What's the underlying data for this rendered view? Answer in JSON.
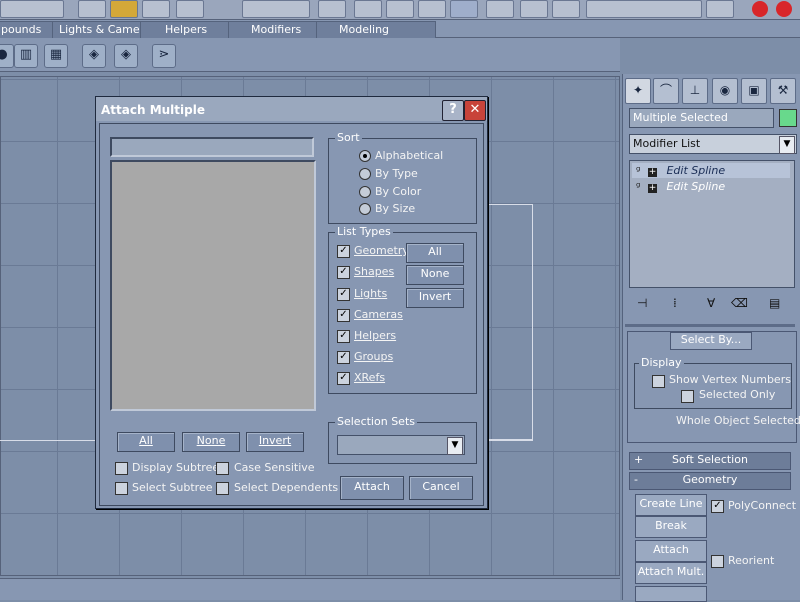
{
  "main_tabs": [
    "pounds",
    "Lights & Cameras",
    "Helpers",
    "Modifiers",
    "Modeling"
  ],
  "command_panel": {
    "selection_name": "Multiple Selected",
    "color_swatch": "#68d98c",
    "modifier_list": "Modifier List",
    "stack_items": [
      "Edit Spline",
      "Edit Spline"
    ],
    "select_by_button": "Select By...",
    "display_group": {
      "label": "Display",
      "show_vertex_numbers": "Show Vertex Numbers",
      "selected_only": "Selected Only"
    },
    "whole_object_selected": "Whole Object Selected",
    "soft_selection": "Soft Selection",
    "geometry": "Geometry",
    "create_line": "Create Line",
    "polyconnect": "PolyConnect",
    "break": "Break",
    "attach": "Attach",
    "reorient": "Reorient",
    "attach_mult": "Attach Mult."
  },
  "dialog": {
    "title": "Attach Multiple",
    "help_label": "?",
    "close_label": "✕",
    "filter_value": "",
    "sort": {
      "label": "Sort",
      "options": [
        "Alphabetical",
        "By Type",
        "By Color",
        "By Size"
      ],
      "selected": "Alphabetical"
    },
    "list_types": {
      "label": "List Types",
      "items": [
        "Geometry",
        "Shapes",
        "Lights",
        "Cameras",
        "Helpers",
        "Groups",
        "XRefs"
      ],
      "all_button": "All",
      "none_button": "None",
      "invert_button": "Invert"
    },
    "list_buttons": {
      "all": "All",
      "none": "None",
      "invert": "Invert"
    },
    "selection_sets": {
      "label": "Selection Sets",
      "value": ""
    },
    "options": {
      "display_subtree": "Display Subtree",
      "case_sensitive": "Case Sensitive",
      "select_subtree": "Select Subtree",
      "select_dependents": "Select Dependents"
    },
    "attach_button": "Attach",
    "cancel_button": "Cancel"
  }
}
